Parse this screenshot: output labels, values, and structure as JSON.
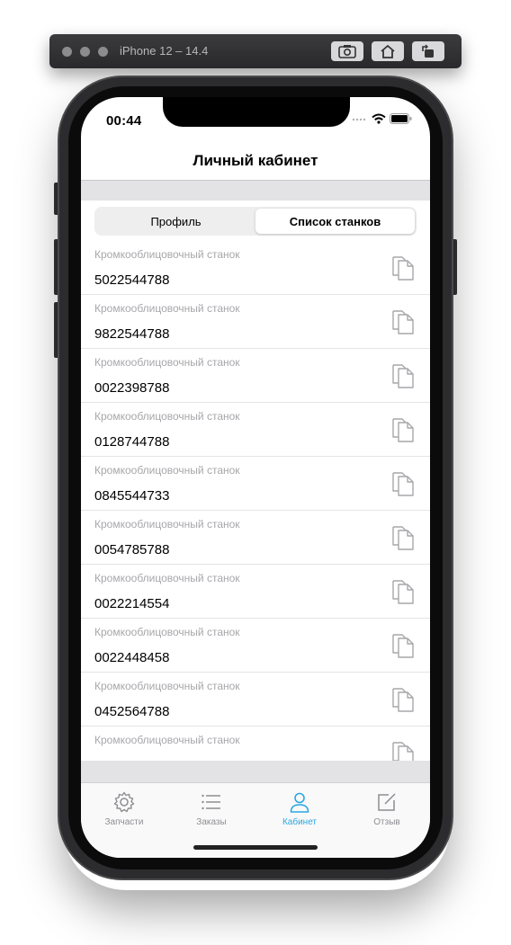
{
  "simulator": {
    "title": "iPhone 12 – 14.4",
    "buttons": [
      "screenshot-icon",
      "home-icon",
      "rotate-icon"
    ]
  },
  "status_bar": {
    "time": "00:44",
    "icons": [
      "signal-icon",
      "wifi-icon",
      "battery-icon"
    ]
  },
  "nav": {
    "title": "Личный кабинет"
  },
  "segmented": {
    "tabs": [
      {
        "label": "Профиль",
        "active": false
      },
      {
        "label": "Список станков",
        "active": true
      }
    ]
  },
  "machines": [
    {
      "title": "Кромкооблицовочный станок",
      "number": "5022544788"
    },
    {
      "title": "Кромкооблицовочный станок",
      "number": "9822544788"
    },
    {
      "title": "Кромкооблицовочный станок",
      "number": "0022398788"
    },
    {
      "title": "Кромкооблицовочный станок",
      "number": "0128744788"
    },
    {
      "title": "Кромкооблицовочный станок",
      "number": "0845544733"
    },
    {
      "title": "Кромкооблицовочный станок",
      "number": "0054785788"
    },
    {
      "title": "Кромкооблицовочный станок",
      "number": "0022214554"
    },
    {
      "title": "Кромкооблицовочный станок",
      "number": "0022448458"
    },
    {
      "title": "Кромкооблицовочный станок",
      "number": "0452564788"
    },
    {
      "title": "Кромкооблицовочный станок",
      "number": ""
    }
  ],
  "tabbar": {
    "items": [
      {
        "label": "Запчасти",
        "icon": "gear-icon"
      },
      {
        "label": "Заказы",
        "icon": "list-icon"
      },
      {
        "label": "Кабинет",
        "icon": "person-icon",
        "active": true
      },
      {
        "label": "Отзыв",
        "icon": "compose-icon"
      }
    ],
    "active_color": "#2aa7e3"
  }
}
